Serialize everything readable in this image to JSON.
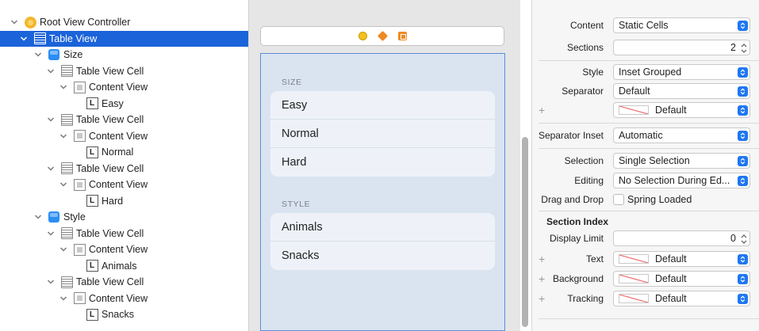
{
  "outline": {
    "items": [
      {
        "label": "Root View Controller",
        "icon": "root-icon",
        "level": 0
      },
      {
        "label": "Table View",
        "icon": "table-icon",
        "level": 1,
        "selected": true
      },
      {
        "label": "Size",
        "icon": "section-icon",
        "level": 2
      },
      {
        "label": "Table View Cell",
        "icon": "table-icon",
        "level": 3
      },
      {
        "label": "Content View",
        "icon": "content-view-icon",
        "level": 4
      },
      {
        "label": "Easy",
        "icon": "label-icon",
        "level": 5
      },
      {
        "label": "Table View Cell",
        "icon": "table-icon",
        "level": 3
      },
      {
        "label": "Content View",
        "icon": "content-view-icon",
        "level": 4
      },
      {
        "label": "Normal",
        "icon": "label-icon",
        "level": 5
      },
      {
        "label": "Table View Cell",
        "icon": "table-icon",
        "level": 3
      },
      {
        "label": "Content View",
        "icon": "content-view-icon",
        "level": 4
      },
      {
        "label": "Hard",
        "icon": "label-icon",
        "level": 5
      },
      {
        "label": "Style",
        "icon": "section-icon",
        "level": 2
      },
      {
        "label": "Table View Cell",
        "icon": "table-icon",
        "level": 3
      },
      {
        "label": "Content View",
        "icon": "content-view-icon",
        "level": 4
      },
      {
        "label": "Animals",
        "icon": "label-icon",
        "level": 5
      },
      {
        "label": "Table View Cell",
        "icon": "table-icon",
        "level": 3
      },
      {
        "label": "Content View",
        "icon": "content-view-icon",
        "level": 4
      },
      {
        "label": "Snacks",
        "icon": "label-icon",
        "level": 5
      }
    ],
    "label_glyph": "L"
  },
  "canvas": {
    "sections": [
      {
        "header": "SIZE",
        "cells": [
          "Easy",
          "Normal",
          "Hard"
        ]
      },
      {
        "header": "STYLE",
        "cells": [
          "Animals",
          "Snacks"
        ]
      }
    ]
  },
  "inspector": {
    "content": {
      "label": "Content",
      "value": "Static Cells"
    },
    "sections": {
      "label": "Sections",
      "value": "2"
    },
    "style": {
      "label": "Style",
      "value": "Inset Grouped"
    },
    "separator": {
      "label": "Separator",
      "value": "Default"
    },
    "separator_color": {
      "value": "Default"
    },
    "separator_inset": {
      "label": "Separator Inset",
      "value": "Automatic"
    },
    "selection": {
      "label": "Selection",
      "value": "Single Selection"
    },
    "editing": {
      "label": "Editing",
      "value": "No Selection During Ed..."
    },
    "drag_drop": {
      "label": "Drag and Drop",
      "option": "Spring Loaded"
    },
    "section_index": {
      "title": "Section Index"
    },
    "display_limit": {
      "label": "Display Limit",
      "value": "0"
    },
    "text": {
      "label": "Text",
      "value": "Default"
    },
    "background": {
      "label": "Background",
      "value": "Default"
    },
    "tracking": {
      "label": "Tracking",
      "value": "Default"
    },
    "plus": "+"
  },
  "colors": {
    "selection": "#1b63d9",
    "accent": "#1e77f2",
    "canvas_bg": "#dae4f1"
  }
}
